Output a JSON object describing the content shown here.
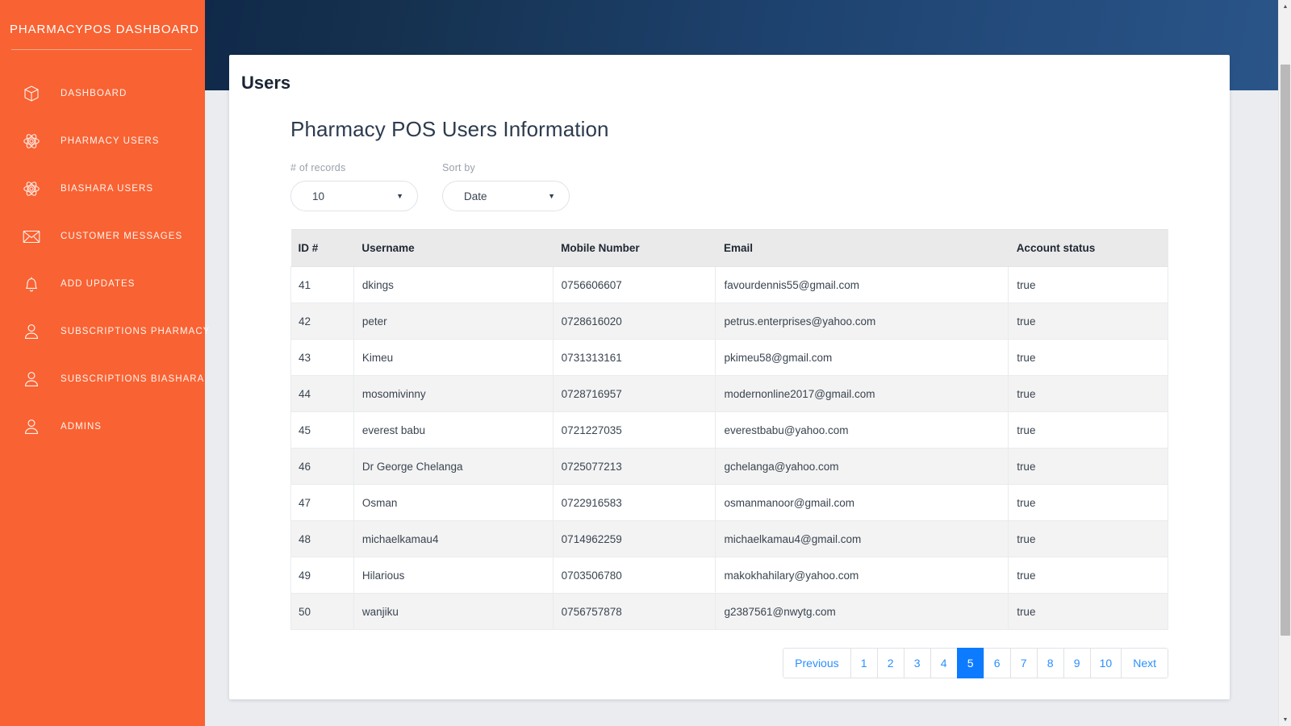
{
  "sidebar": {
    "brand": "PHARMACYPOS DASHBOARD",
    "items": [
      {
        "label": "DASHBOARD",
        "icon": "cube-icon"
      },
      {
        "label": "PHARMACY USERS",
        "icon": "atom-icon"
      },
      {
        "label": "BIASHARA USERS",
        "icon": "atom-icon"
      },
      {
        "label": "CUSTOMER MESSAGES",
        "icon": "envelope-icon"
      },
      {
        "label": "ADD UPDATES",
        "icon": "bell-icon"
      },
      {
        "label": "SUBSCRIPTIONS PHARMACY",
        "icon": "user-icon"
      },
      {
        "label": "SUBSCRIPTIONS BIASHARA",
        "icon": "user-icon"
      },
      {
        "label": "ADMINS",
        "icon": "user-icon"
      }
    ]
  },
  "main": {
    "page_title": "Users",
    "section_title": "Pharmacy POS Users Information",
    "filters": {
      "records": {
        "label": "# of records",
        "value": "10",
        "caret": "▼"
      },
      "sort": {
        "label": "Sort by",
        "value": "Date",
        "caret": "▼"
      }
    },
    "table": {
      "columns": [
        "ID #",
        "Username",
        "Mobile Number",
        "Email",
        "Account status"
      ],
      "rows": [
        {
          "id": "41",
          "username": "dkings",
          "mobile": "0756606607",
          "email": "favourdennis55@gmail.com",
          "status": "true"
        },
        {
          "id": "42",
          "username": "peter",
          "mobile": "0728616020",
          "email": "petrus.enterprises@yahoo.com",
          "status": "true"
        },
        {
          "id": "43",
          "username": "Kimeu",
          "mobile": "0731313161",
          "email": "pkimeu58@gmail.com",
          "status": "true"
        },
        {
          "id": "44",
          "username": "mosomivinny",
          "mobile": "0728716957",
          "email": "modernonline2017@gmail.com",
          "status": "true"
        },
        {
          "id": "45",
          "username": "everest babu",
          "mobile": "0721227035",
          "email": "everestbabu@yahoo.com",
          "status": "true"
        },
        {
          "id": "46",
          "username": "Dr George Chelanga",
          "mobile": "0725077213",
          "email": "gchelanga@yahoo.com",
          "status": "true"
        },
        {
          "id": "47",
          "username": "Osman",
          "mobile": "0722916583",
          "email": "osmanmanoor@gmail.com",
          "status": "true"
        },
        {
          "id": "48",
          "username": "michaelkamau4",
          "mobile": "0714962259",
          "email": "michaelkamau4@gmail.com",
          "status": "true"
        },
        {
          "id": "49",
          "username": "Hilarious",
          "mobile": "0703506780",
          "email": "makokhahilary@yahoo.com",
          "status": "true"
        },
        {
          "id": "50",
          "username": "wanjiku",
          "mobile": "0756757878",
          "email": "g2387561@nwytg.com",
          "status": "true"
        }
      ]
    },
    "pagination": {
      "previous_label": "Previous",
      "next_label": "Next",
      "pages": [
        "1",
        "2",
        "3",
        "4",
        "5",
        "6",
        "7",
        "8",
        "9",
        "10"
      ],
      "active_page": "5"
    }
  },
  "scrollbar": {
    "up_arrow": "▲",
    "down_arrow": "▼"
  },
  "colors": {
    "sidebar_bg": "#f96232",
    "topbar_dark": "#10294a",
    "topbar_light": "#2a5589",
    "accent_blue": "#0d7bff",
    "link_blue": "#2a8fff",
    "page_bg": "#eaecf0"
  }
}
